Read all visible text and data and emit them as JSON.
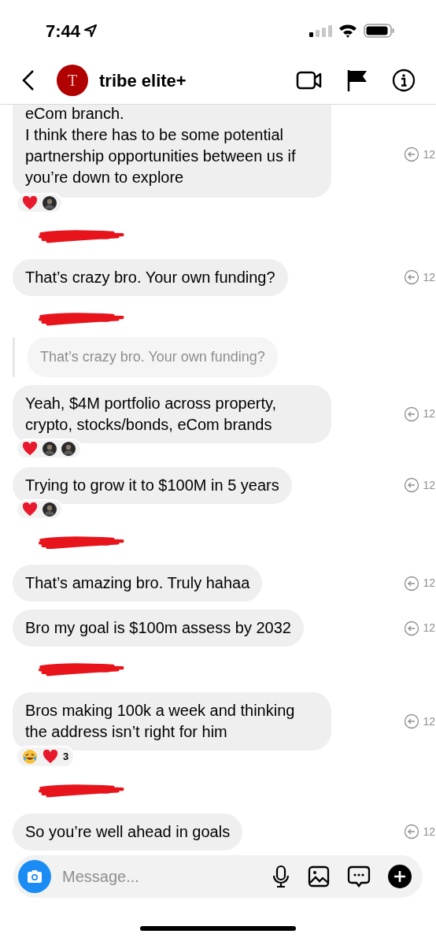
{
  "status_bar": {
    "time": "7:44"
  },
  "header": {
    "avatar_letter": "T",
    "title": "tribe elite+"
  },
  "messages": [
    {
      "kind": "message",
      "cut_top": true,
      "lines": [
        "eCom branch.",
        "I think there has to be some potential partnership opportunities between us if you’re down to explore"
      ],
      "time": "12",
      "reactions": [
        {
          "kind": "heart"
        },
        {
          "kind": "avatar"
        }
      ]
    },
    {
      "kind": "redaction"
    },
    {
      "kind": "message",
      "lines": [
        "That’s crazy bro. Your own funding?"
      ],
      "time": "12"
    },
    {
      "kind": "redaction"
    },
    {
      "kind": "reply",
      "text": "That’s crazy bro. Your own funding?"
    },
    {
      "kind": "message",
      "lines": [
        "Yeah, $4M portfolio across property, crypto, stocks/bonds, eCom brands"
      ],
      "time": "12",
      "reactions": [
        {
          "kind": "heart"
        },
        {
          "kind": "avatar"
        },
        {
          "kind": "avatar"
        }
      ]
    },
    {
      "kind": "message",
      "lines": [
        "Trying to grow it to $100M in 5 years"
      ],
      "time": "12",
      "reactions": [
        {
          "kind": "heart"
        },
        {
          "kind": "avatar"
        }
      ]
    },
    {
      "kind": "redaction"
    },
    {
      "kind": "message",
      "lines": [
        "That’s amazing bro. Truly hahaa"
      ],
      "time": "12"
    },
    {
      "kind": "message",
      "lines": [
        "Bro my goal is $100m assess by 2032"
      ],
      "time": "12"
    },
    {
      "kind": "redaction"
    },
    {
      "kind": "message",
      "lines": [
        "Bros making 100k a week and thinking the address isn’t right for him"
      ],
      "time": "12",
      "reactions": [
        {
          "kind": "laugh"
        },
        {
          "kind": "heart"
        }
      ],
      "reaction_count": "3"
    },
    {
      "kind": "redaction"
    },
    {
      "kind": "message",
      "lines": [
        "So you’re well ahead in goals"
      ],
      "time": "12"
    }
  ],
  "composer": {
    "placeholder": "Message..."
  }
}
